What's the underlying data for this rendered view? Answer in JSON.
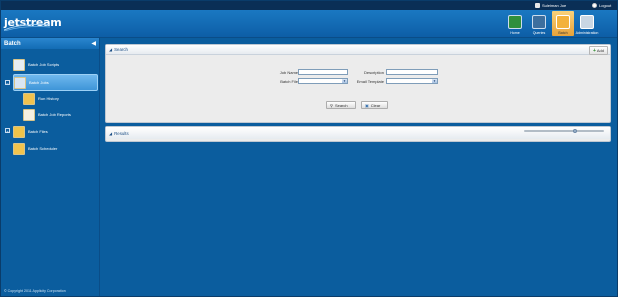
{
  "app": {
    "logo_text": "jetstream"
  },
  "utility_bar": {
    "user_label": "Suleiman Joe",
    "logout_label": "Logout"
  },
  "nav": {
    "items": [
      {
        "label": "Home",
        "icon": "home-icon"
      },
      {
        "label": "Queries",
        "icon": "queries-icon"
      },
      {
        "label": "Batch",
        "icon": "batch-icon",
        "active": true
      },
      {
        "label": "Administration",
        "icon": "administration-icon"
      }
    ]
  },
  "sidebar": {
    "title": "Batch",
    "items": [
      {
        "label": "Batch Job Scripts",
        "icon": "script-icon"
      },
      {
        "label": "Batch Jobs",
        "icon": "batch-jobs-icon",
        "selected": true
      },
      {
        "label": "Run History",
        "icon": "run-history-icon"
      },
      {
        "label": "Batch Job Reports",
        "icon": "reports-icon"
      },
      {
        "label": "Batch Files",
        "icon": "folder-icon"
      },
      {
        "label": "Batch Scheduler",
        "icon": "scheduler-icon"
      }
    ],
    "copyright": "© Copyright 2011 Applicity Corporation"
  },
  "search_panel": {
    "title": "Search",
    "add_label": "Add",
    "fields": {
      "job_name_label": "Job Name",
      "job_name_value": "",
      "description_label": "Description",
      "description_value": "",
      "batch_file_label": "Batch File",
      "batch_file_value": "",
      "email_template_label": "Email Template",
      "email_template_value": ""
    },
    "search_button": "Search",
    "clear_button": "Clear"
  },
  "results_panel": {
    "title": "Results"
  },
  "colors": {
    "brand_blue": "#0b5d9e",
    "active_tab": "#e6a23a",
    "header_dark": "#0a2f56"
  }
}
